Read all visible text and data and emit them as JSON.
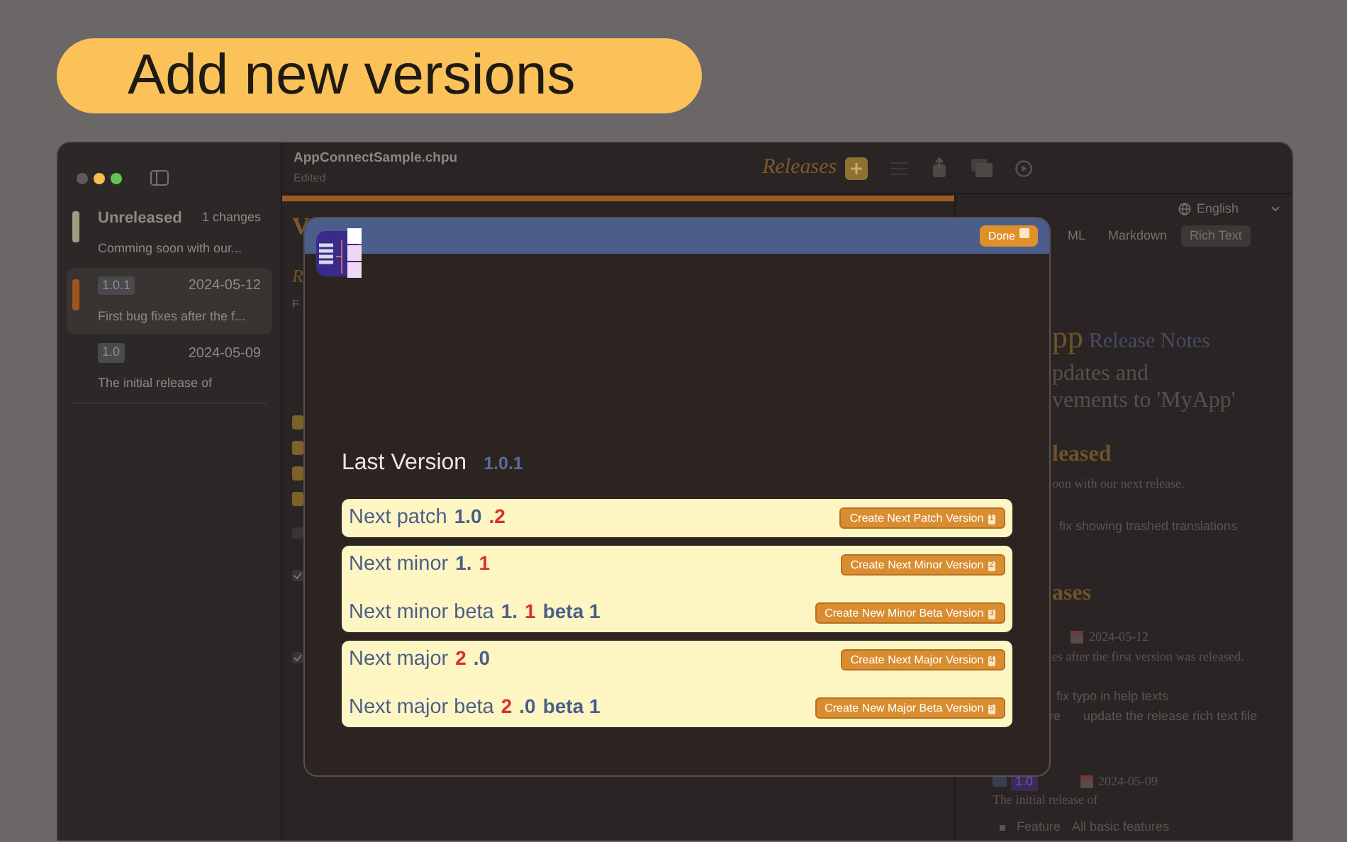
{
  "headline": "Add new versions",
  "document": {
    "title": "AppConnectSample.chpu",
    "subtitle": "Edited"
  },
  "toolbar": {
    "title": "Releases"
  },
  "sidebar": {
    "items": [
      {
        "title": "Unreleased",
        "count": "1 changes",
        "description": "Comming soon with our...",
        "color": "#a29d80",
        "selected": false
      },
      {
        "badge": "1.0.1",
        "date": "2024-05-12",
        "description": "First bug fixes after the f...",
        "color": "#a0561a",
        "selected": true
      },
      {
        "badge": "1.0",
        "date": "2024-05-09",
        "description": "The initial release of",
        "selected": false
      }
    ]
  },
  "editor": {
    "heading": "V",
    "subheading": "R",
    "label": "F",
    "progress": {
      "level": 1
    },
    "checkboxes": [
      {
        "checked": false
      },
      {
        "checked": true
      },
      {
        "checked": true
      }
    ]
  },
  "preview": {
    "language": "English",
    "tabs": [
      {
        "label": "ML",
        "selected": false
      },
      {
        "label": "Markdown",
        "selected": false
      },
      {
        "label": "Rich Text",
        "selected": true
      }
    ],
    "title_app": "pp",
    "title_rest": "Release Notes",
    "intro": [
      "pdates and",
      "vements to 'MyApp'"
    ],
    "section_1": "leased",
    "section_1_text": "oon with our next release.",
    "change_1": "fix showing trashed translations",
    "section_2": "ases",
    "release_1_date": "2024-05-12",
    "release_1_text": "es after the first version was released.",
    "change_2": "fix typo in help texts",
    "change_3_kind": "re",
    "change_3": "update the release rich text file",
    "release_2_badge": "1.0",
    "release_2_date": "2024-05-09",
    "release_2_text": "The initial release of",
    "feature_kind": "Feature",
    "feature": "All basic features"
  },
  "sheet": {
    "done": "Done",
    "last_version_label": "Last Version",
    "last_version": "1.0.1",
    "groups": [
      {
        "rows": [
          {
            "label": "Next patch",
            "parts": [
              {
                "text": "1.0",
                "kind": "base"
              },
              {
                "text": ".2",
                "kind": "bumped"
              }
            ],
            "button": "Create Next Patch Version",
            "shortcut": "1"
          }
        ]
      },
      {
        "rows": [
          {
            "label": "Next minor",
            "parts": [
              {
                "text": "1.",
                "kind": "base"
              },
              {
                "text": "1",
                "kind": "bumped"
              }
            ],
            "button": "Create Next Minor Version",
            "shortcut": "2"
          },
          {
            "label": "Next minor beta",
            "parts": [
              {
                "text": "1.",
                "kind": "base"
              },
              {
                "text": "1",
                "kind": "bumped"
              },
              {
                "text": "beta 1",
                "kind": "base"
              }
            ],
            "button": "Create New Minor Beta Version",
            "shortcut": "3"
          }
        ]
      },
      {
        "rows": [
          {
            "label": "Next major",
            "parts": [
              {
                "text": "2",
                "kind": "bumped"
              },
              {
                "text": ".0",
                "kind": "base"
              }
            ],
            "button": "Create Next Major Version",
            "shortcut": "4"
          },
          {
            "label": "Next major beta",
            "parts": [
              {
                "text": "2",
                "kind": "bumped"
              },
              {
                "text": ".0",
                "kind": "base"
              },
              {
                "text": "beta 1",
                "kind": "base"
              }
            ],
            "button": "Create New Major Beta Version",
            "shortcut": "5"
          }
        ]
      }
    ]
  }
}
